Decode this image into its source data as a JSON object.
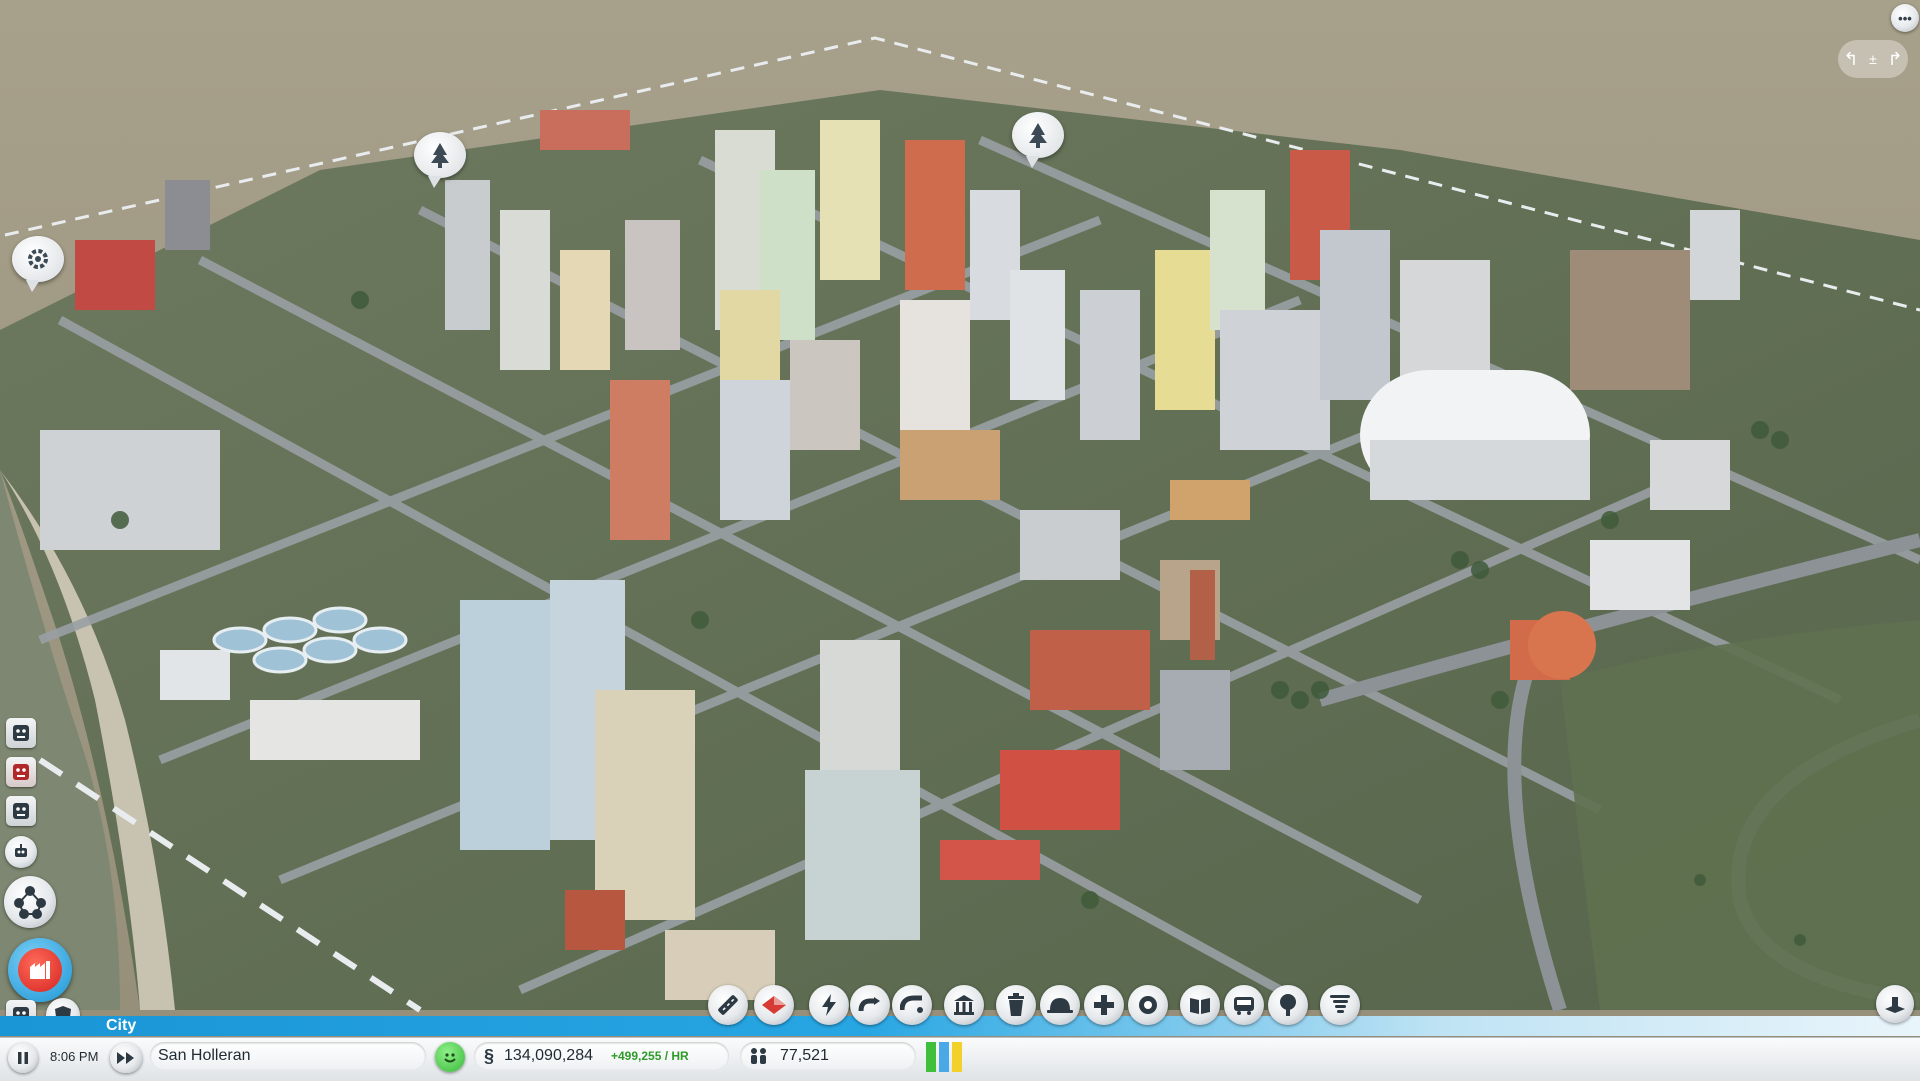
{
  "colors": {
    "accent_blue": "#1a95d6",
    "fire_red": "#e0302a",
    "happy_green": "#3bb93a",
    "sea": "#a49c84",
    "grass": "#5c6e4e",
    "road": "#8e9499"
  },
  "mode_strip": {
    "label": "City"
  },
  "status_bar": {
    "time": "8:06 PM",
    "city_name": "San Holleran",
    "funds": "134,090,284",
    "income": "+499,255 / HR",
    "population": "77,521"
  },
  "map_bubbles": [
    {
      "name": "park-alert-bubble",
      "icon": "tree-icon"
    },
    {
      "name": "park-alert-bubble",
      "icon": "tree-icon"
    },
    {
      "name": "utility-alert-bubble",
      "icon": "gear-icon"
    }
  ],
  "left_toolbar": [
    {
      "name": "resident-face-icon"
    },
    {
      "name": "resident-face-icon-alert"
    },
    {
      "name": "resident-face-icon"
    },
    {
      "name": "robot-icon"
    },
    {
      "name": "region-network-icon"
    },
    {
      "name": "fire-station-icon"
    },
    {
      "name": "resident-face-icon"
    },
    {
      "name": "police-shield-icon"
    }
  ],
  "build_tools": [
    "road-tool-icon",
    "zone-tool-icon",
    "power-bolt-icon",
    "water-pipe-icon",
    "sewage-icon",
    "government-building-icon",
    "garbage-can-icon",
    "fire-helmet-icon",
    "health-cross-icon",
    "police-badge-icon",
    "education-book-icon",
    "transport-bus-icon",
    "parks-tree-icon",
    "landmark-tornado-icon"
  ],
  "power_meter": {
    "levels": [
      "green",
      "blue",
      "yellow"
    ]
  }
}
